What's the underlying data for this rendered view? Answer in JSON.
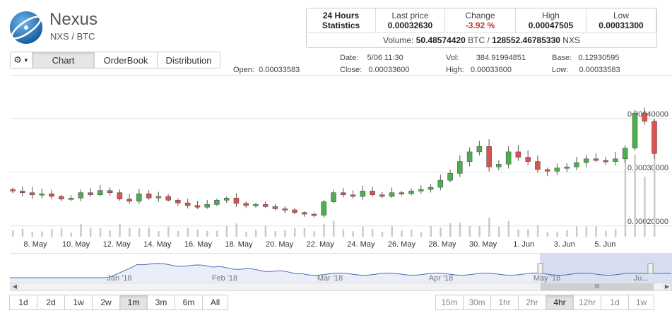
{
  "coin": {
    "name": "Nexus",
    "pair": "NXS / BTC"
  },
  "stats": {
    "period_line1": "24 Hours",
    "period_line2": "Statistics",
    "last_price_label": "Last price",
    "last_price": "0.00032630",
    "change_label": "Change",
    "change": "-3.92 %",
    "high_label": "High",
    "high": "0.00047505",
    "low_label": "Low",
    "low": "0.00031300",
    "volume_label": "Volume:",
    "volume_btc": "50.48574420",
    "btc_unit": "BTC /",
    "volume_nxs": "128552.46785330",
    "nxs_unit": "NXS"
  },
  "toolbar": {
    "chart": "Chart",
    "orderbook": "OrderBook",
    "distribution": "Distribution"
  },
  "ohlc": {
    "open_label": "Open:",
    "open": "0.00033583",
    "date_label": "Date:",
    "date": "5/06 11:30",
    "close_label": "Close:",
    "close": "0.00033600",
    "vol_label": "Vol:",
    "vol": "384.91994851",
    "high_label": "High:",
    "high": "0.00033600",
    "base_label": "Base:",
    "base": "0.12930595",
    "low_label": "Low:",
    "low": "0.00033583"
  },
  "colors": {
    "up": "#4cae4c",
    "down": "#d9534f",
    "volume": "#c8c8c8",
    "navigator_line": "#4a6fb5",
    "navigator_fill": "#dbe3f3",
    "selection": "#c5cfea"
  },
  "xaxis_labels": [
    "8. May",
    "10. May",
    "12. May",
    "14. May",
    "16. May",
    "18. May",
    "20. May",
    "22. May",
    "24. May",
    "26. May",
    "28. May",
    "30. May",
    "1. Jun",
    "3. Jun",
    "5. Jun"
  ],
  "navigator_labels": [
    "Jan '18",
    "Feb '18",
    "Mar '18",
    "Apr '18",
    "May '18",
    "Ju..."
  ],
  "range_left": [
    "1d",
    "2d",
    "1w",
    "2w",
    "1m",
    "3m",
    "6m",
    "All"
  ],
  "range_left_active": "1m",
  "range_right": [
    "15m",
    "30m",
    "1hr",
    "2hr",
    "4hr",
    "12hr",
    "1d",
    "1w"
  ],
  "range_right_active": "4hr",
  "chart_data": {
    "type": "candlestick",
    "x_range": [
      "7. May",
      "6. Jun"
    ],
    "y_ticks": [
      "0.00020000",
      "0.00030000",
      "0.00040000"
    ],
    "ylim": [
      0.00018,
      0.00048
    ],
    "grid": true,
    "series": [
      {
        "values": [
          0.000265,
          0.000262,
          0.000258,
          0.00026,
          0.000255,
          0.00025,
          0.000252,
          0.000262,
          0.000258,
          0.000266,
          0.000262,
          0.00025,
          0.000246,
          0.00026,
          0.000252,
          0.000255,
          0.000248,
          0.000243,
          0.000238,
          0.000235,
          0.00024,
          0.000248,
          0.000252,
          0.000242,
          0.000238,
          0.00024,
          0.000236,
          0.000232,
          0.00023,
          0.000225,
          0.000222,
          0.00022,
          0.000245,
          0.000262,
          0.000258,
          0.000255,
          0.000265,
          0.000258,
          0.000255,
          0.000262,
          0.00026,
          0.000265,
          0.000268,
          0.000272,
          0.000285,
          0.000298,
          0.00032,
          0.000338,
          0.000348,
          0.00031,
          0.000315,
          0.000338,
          0.000328,
          0.00032,
          0.000305,
          0.000302,
          0.000308,
          0.00031,
          0.000318,
          0.000325,
          0.000322,
          0.00032,
          0.000325,
          0.000345,
          0.00041,
          0.000395,
          0.000335
        ]
      }
    ]
  }
}
